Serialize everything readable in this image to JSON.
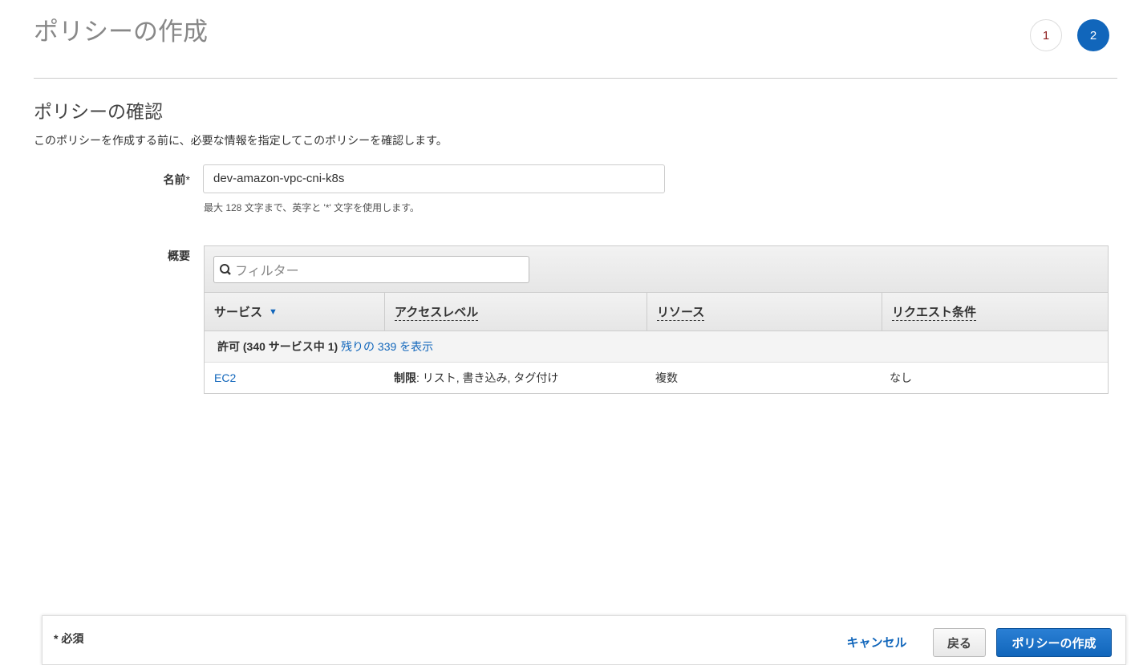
{
  "header": {
    "title": "ポリシーの作成",
    "steps": [
      "1",
      "2"
    ]
  },
  "section": {
    "title": "ポリシーの確認",
    "description": "このポリシーを作成する前に、必要な情報を指定してこのポリシーを確認します。"
  },
  "name": {
    "label": "名前",
    "required_mark": "*",
    "value": "dev-amazon-vpc-cni-k8s",
    "hint": "最大 128 文字まで、英字と '*' 文字を使用します。"
  },
  "summary": {
    "label": "概要",
    "filter_placeholder": "フィルター",
    "columns": [
      "サービス",
      "アクセスレベル",
      "リソース",
      "リクエスト条件"
    ],
    "group": {
      "text": "許可 (340 サービス中 1)",
      "link": "残りの 339 を表示"
    },
    "rows": [
      {
        "service": "EC2",
        "access_bold": "制限",
        "access_rest": ": リスト, 書き込み, タグ付け",
        "resource": "複数",
        "condition": "なし"
      }
    ]
  },
  "footer": {
    "required": "* 必須",
    "cancel": "キャンセル",
    "back": "戻る",
    "create": "ポリシーの作成"
  }
}
